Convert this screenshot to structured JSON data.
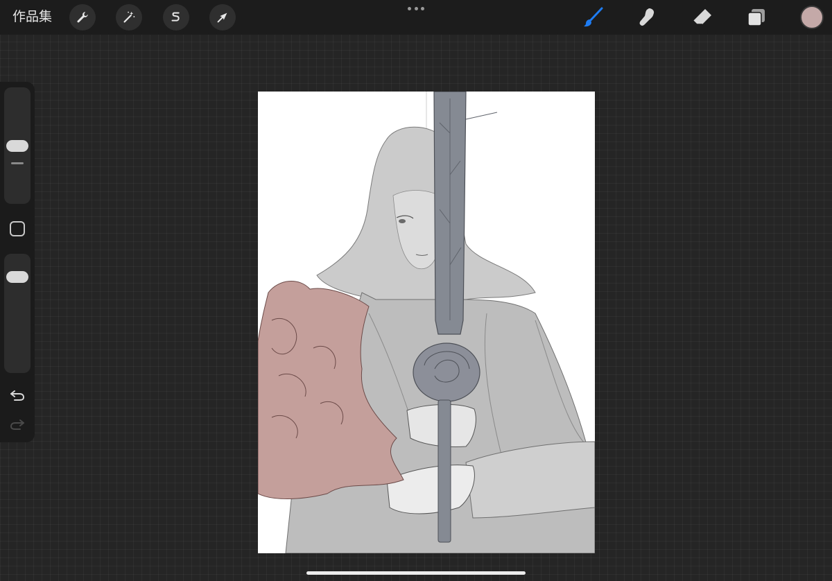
{
  "topbar": {
    "gallery_label": "作品集",
    "left_tools": [
      {
        "icon": "wrench-icon",
        "label": "actions"
      },
      {
        "icon": "magic-wand-icon",
        "label": "adjustments"
      },
      {
        "icon": "selection-s-icon",
        "label": "selection"
      },
      {
        "icon": "arrow-cursor-icon",
        "label": "transform"
      }
    ],
    "right_tools": [
      {
        "icon": "brush-icon",
        "active": true
      },
      {
        "icon": "smudge-icon",
        "active": false
      },
      {
        "icon": "eraser-icon",
        "active": false
      },
      {
        "icon": "layers-icon",
        "active": false
      }
    ],
    "active_color": "#c4a9a8",
    "accent": "#1e7cf2"
  },
  "sidebar": {
    "brush_size_level": 0.5,
    "opacity_level": 0.85
  },
  "canvas": {
    "paper": "#ffffff",
    "fill_gray": "#b9b9b9",
    "sword_color": "#7f838c",
    "flower_color": "#c49f9b"
  }
}
